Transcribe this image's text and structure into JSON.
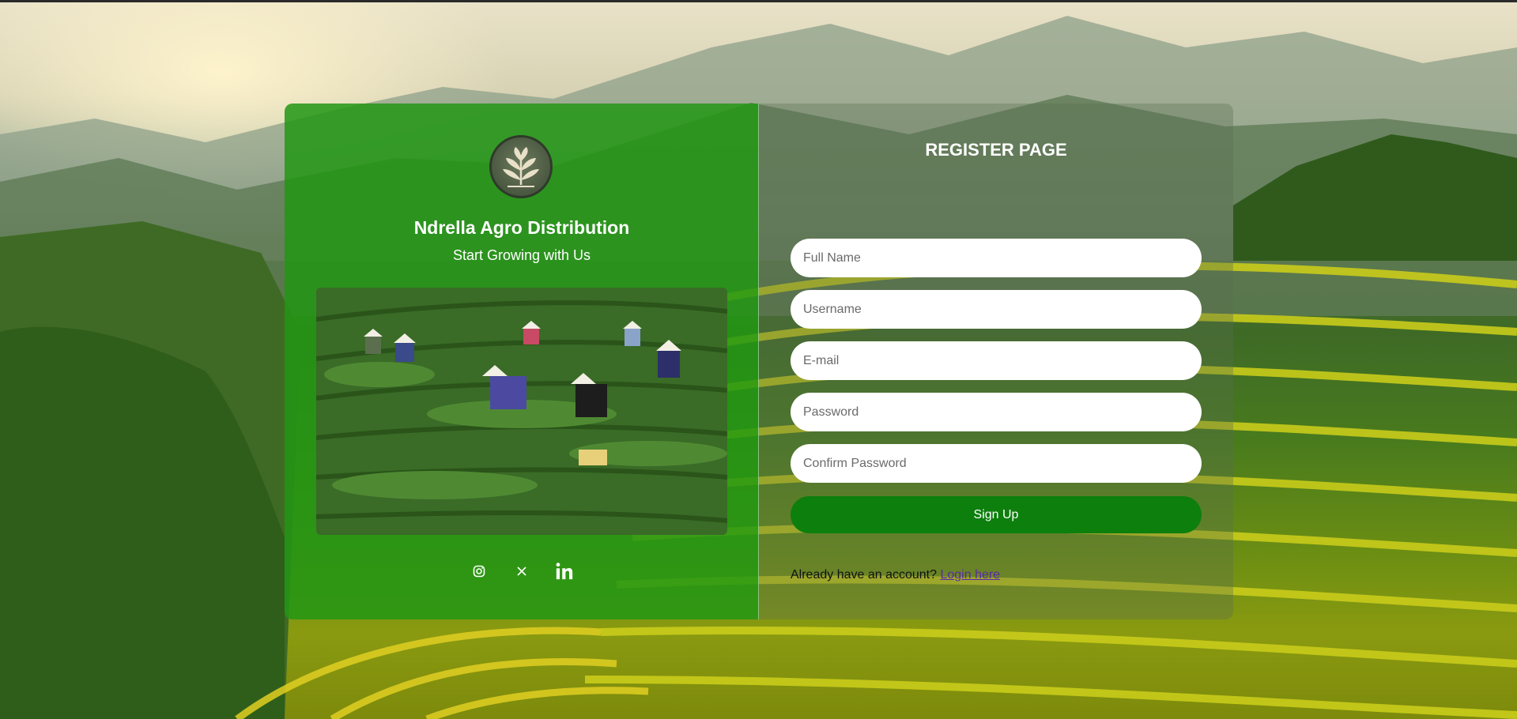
{
  "brand": {
    "name": "Ndrella Agro Distribution",
    "tagline": "Start Growing with Us"
  },
  "register": {
    "title": "REGISTER PAGE",
    "fields": {
      "full_name_placeholder": "Full Name",
      "username_placeholder": "Username",
      "email_placeholder": "E-mail",
      "password_placeholder": "Password",
      "confirm_password_placeholder": "Confirm Password"
    },
    "signup_label": "Sign Up",
    "login_prompt": "Already have an account?",
    "login_link": "Login here"
  },
  "socials": [
    "instagram-icon",
    "x-icon",
    "linkedin-icon"
  ],
  "colors": {
    "left_panel": "#229614",
    "signup_button": "#0d7f0d",
    "login_link": "#5b2aa6"
  }
}
